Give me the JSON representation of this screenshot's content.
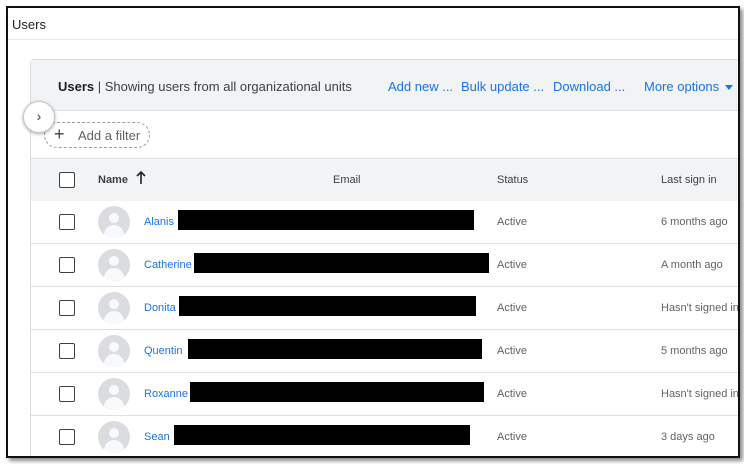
{
  "page": {
    "title": "Users"
  },
  "header": {
    "title_bold": "Users",
    "title_rest": " | Showing users from all organizational units",
    "actions": [
      {
        "label": "Add new ..."
      },
      {
        "label": "Bulk update ..."
      },
      {
        "label": "Download ..."
      },
      {
        "label": "More options"
      }
    ]
  },
  "filter": {
    "label": "Add a filter",
    "icon": "plus-icon"
  },
  "expand": {
    "icon": "chevron-right-icon",
    "glyph": "›"
  },
  "table": {
    "columns": [
      {
        "label": "Name",
        "sorted": "ascending"
      },
      {
        "label": "Email"
      },
      {
        "label": "Status"
      },
      {
        "label": "Last sign in"
      }
    ],
    "rows": [
      {
        "name": "Alanis",
        "status": "Active",
        "last_sign_in": "6 months ago"
      },
      {
        "name": "Catherine",
        "status": "Active",
        "last_sign_in": "A month ago"
      },
      {
        "name": "Donita",
        "status": "Active",
        "last_sign_in": "Hasn't signed in"
      },
      {
        "name": "Quentin",
        "status": "Active",
        "last_sign_in": "5 months ago"
      },
      {
        "name": "Roxanne",
        "status": "Active",
        "last_sign_in": "Hasn't signed in"
      },
      {
        "name": "Sean",
        "status": "Active",
        "last_sign_in": "3 days ago"
      }
    ]
  },
  "colors": {
    "link": "#1a73e8",
    "header_bg": "#f1f3f4",
    "redaction": "#000000"
  }
}
